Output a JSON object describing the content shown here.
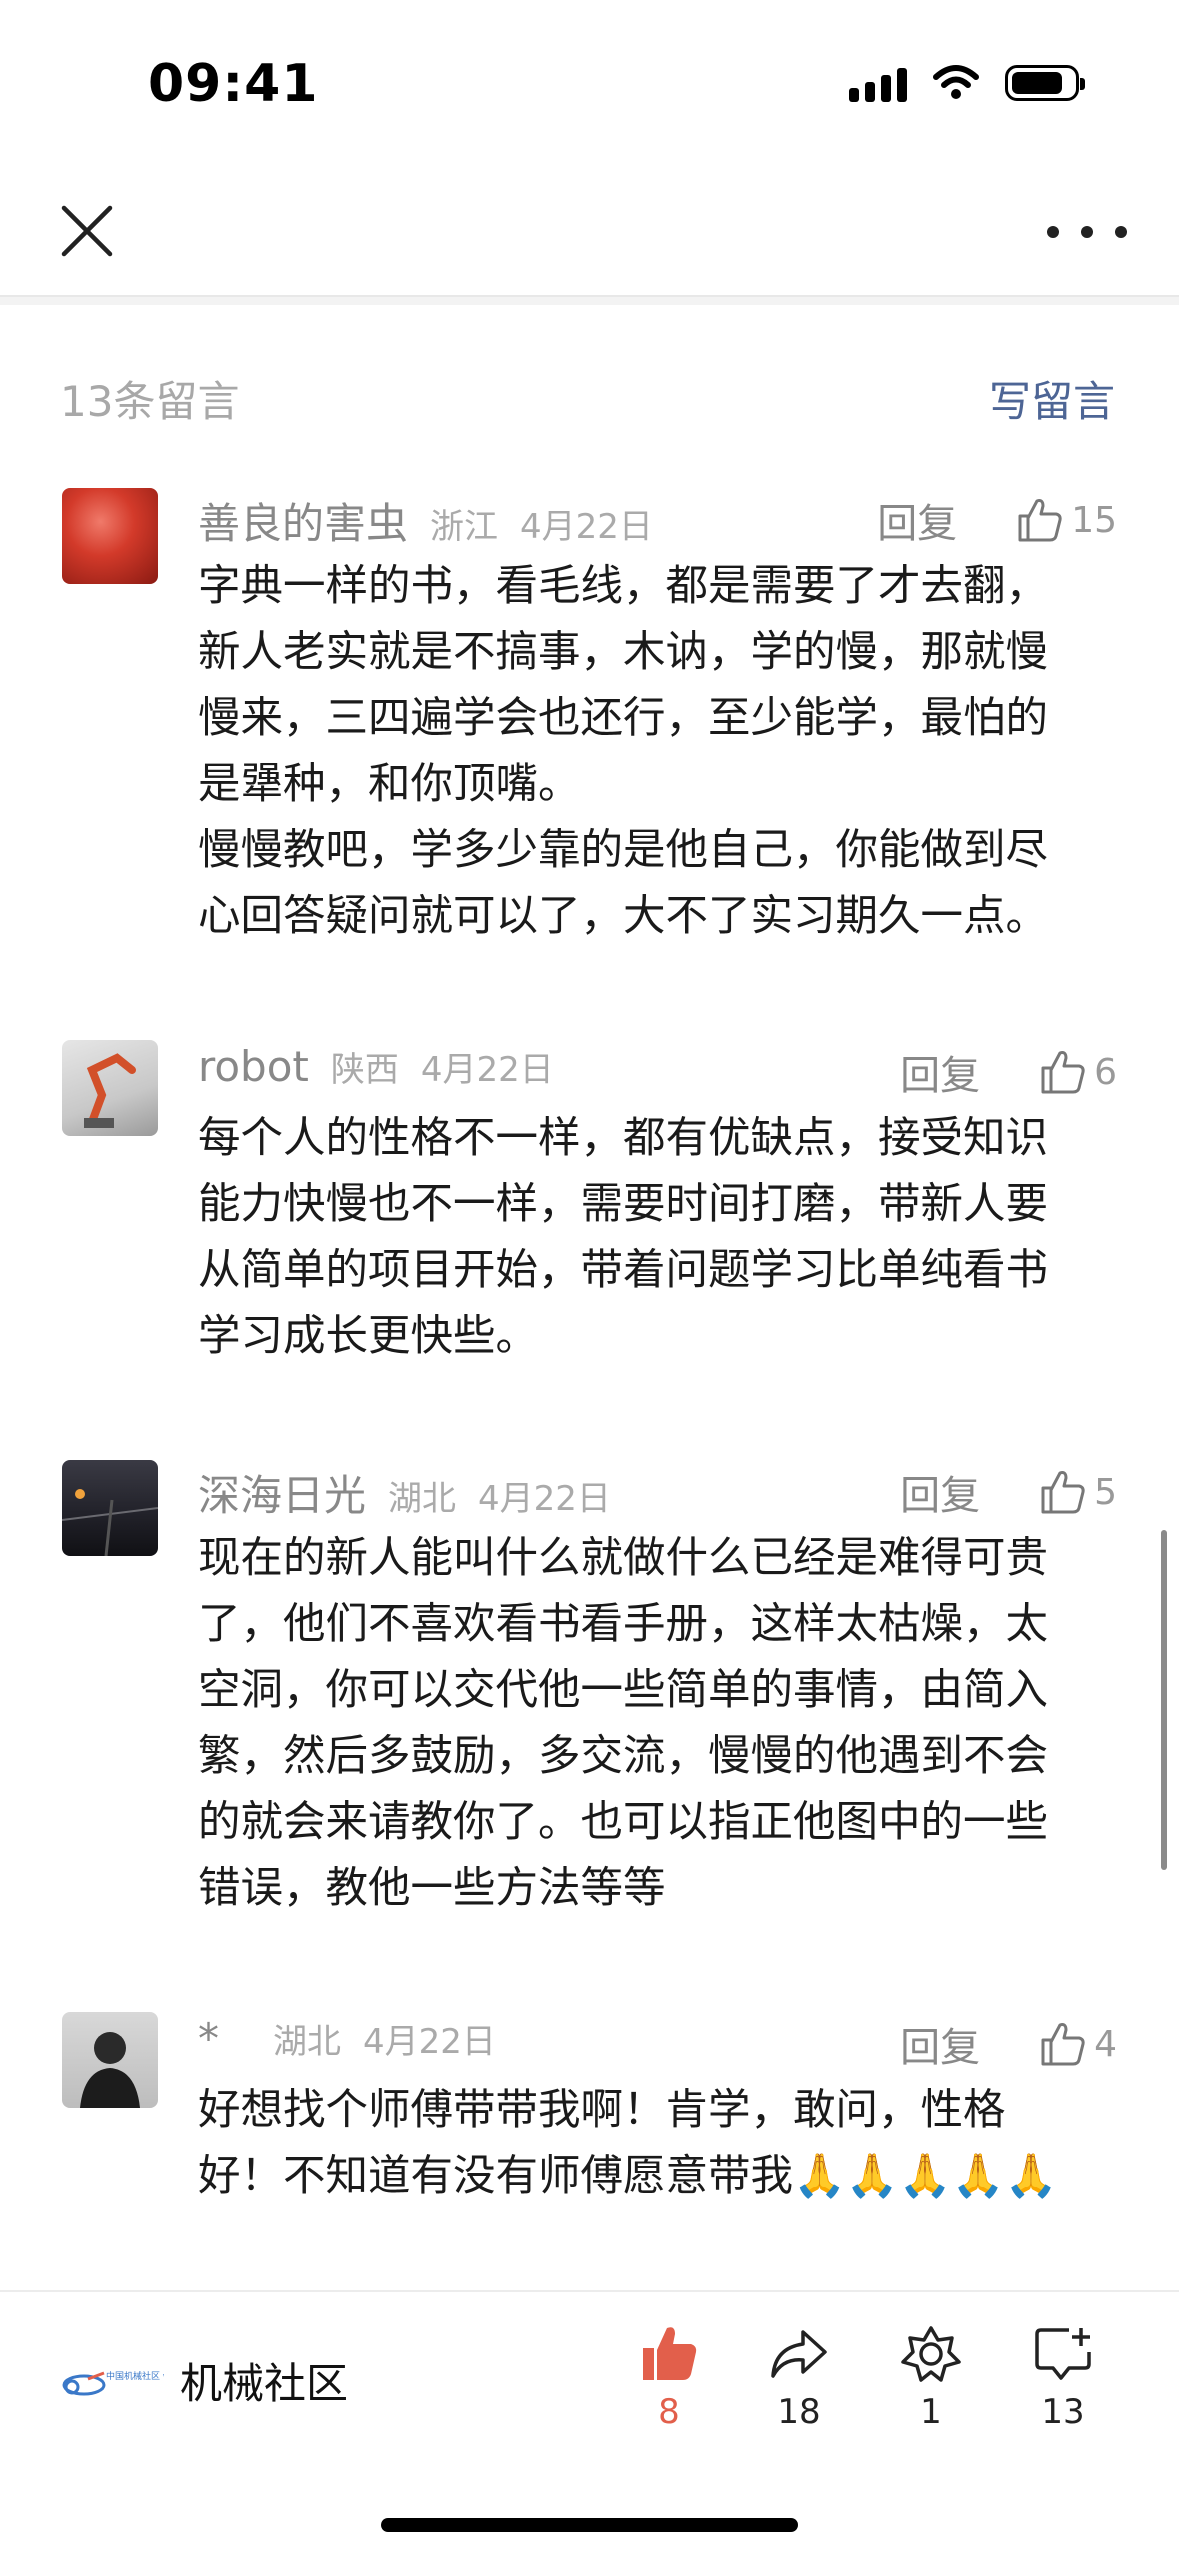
{
  "status_bar": {
    "time": "09:41",
    "icons": [
      "cellular-signal-icon",
      "wifi-icon",
      "battery-icon"
    ]
  },
  "nav": {
    "close_icon": "close-icon",
    "more_icon": "more-icon"
  },
  "comments_header": {
    "count_label": "13条留言",
    "write_label": "写留言"
  },
  "comments": [
    {
      "name": "善良的害虫",
      "location": "浙江",
      "date": "4月22日",
      "reply": "回复",
      "likes": "15",
      "text": "字典一样的书，看毛线，都是需要了才去翻，\n新人老实就是不搞事，木讷，学的慢，那就慢\n慢来，三四遍学会也还行，至少能学，最怕的\n是犟种，和你顶嘴。\n慢慢教吧，学多少靠的是他自己，你能做到尽\n心回答疑问就可以了，大不了实习期久一点。"
    },
    {
      "name": "robot",
      "location": "陕西",
      "date": "4月22日",
      "reply": "回复",
      "likes": "6",
      "text": "每个人的性格不一样，都有优缺点，接受知识\n能力快慢也不一样，需要时间打磨，带新人要\n从简单的项目开始，带着问题学习比单纯看书\n学习成长更快些。"
    },
    {
      "name": "深海日光",
      "location": "湖北",
      "date": "4月22日",
      "reply": "回复",
      "likes": "5",
      "text": "现在的新人能叫什么就做什么已经是难得可贵\n了，他们不喜欢看书看手册，这样太枯燥，太\n空洞，你可以交代他一些简单的事情，由简入\n繁，然后多鼓励，多交流，慢慢的他遇到不会\n的就会来请教你了。也可以指正他图中的一些\n错误，教他一些方法等等"
    },
    {
      "name": "*",
      "location": "湖北",
      "date": "4月22日",
      "reply": "回复",
      "likes": "4",
      "text": "好想找个师傅带带我啊！肯学，敢问，性格\n好！不知道有没有师傅愿意带我🙏🙏🙏🙏🙏"
    }
  ],
  "bottom_bar": {
    "account_name": "机械社区",
    "logo_text": "中国机械社区 www.cmiw.cn",
    "like_count": "8",
    "share_count": "18",
    "recommend_count": "1",
    "comment_count": "13"
  },
  "colors": {
    "link": "#4d6595",
    "liked": "#e25f4b",
    "muted": "#a8a8a8"
  }
}
